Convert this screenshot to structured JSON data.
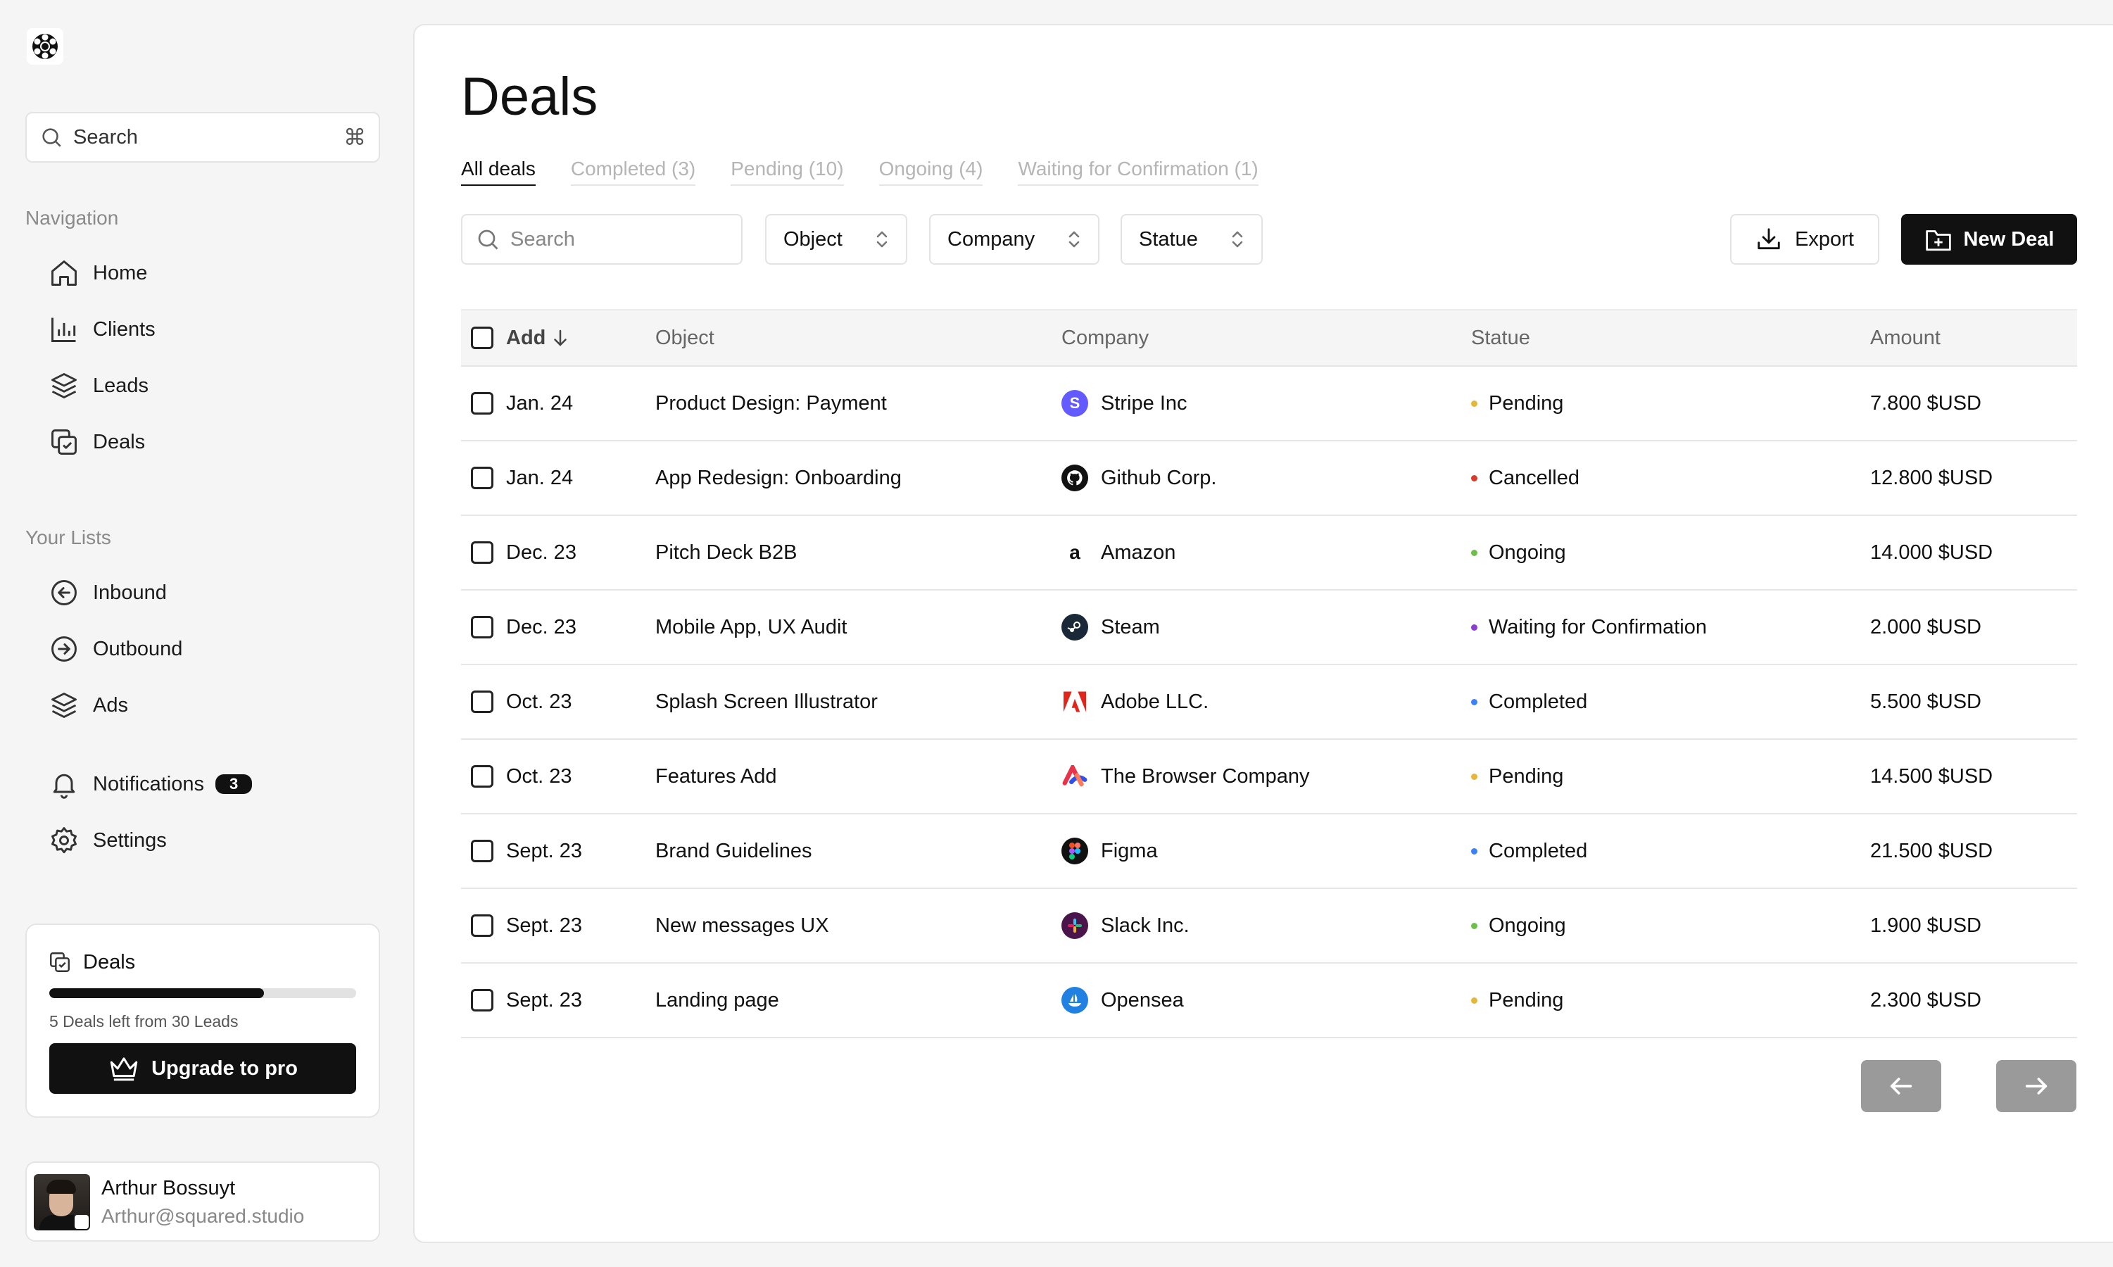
{
  "sidebar": {
    "search": {
      "placeholder": "Search",
      "shortcut": "⌘"
    },
    "nav_heading": "Navigation",
    "nav": [
      {
        "label": "Home",
        "icon": "home-icon"
      },
      {
        "label": "Clients",
        "icon": "bar-chart-icon"
      },
      {
        "label": "Leads",
        "icon": "layers-icon"
      },
      {
        "label": "Deals",
        "icon": "deals-icon"
      }
    ],
    "lists_heading": "Your Lists",
    "lists": [
      {
        "label": "Inbound",
        "icon": "arrow-left-circle-icon"
      },
      {
        "label": "Outbound",
        "icon": "arrow-right-circle-icon"
      },
      {
        "label": "Ads",
        "icon": "layers-icon"
      }
    ],
    "notifications": {
      "label": "Notifications",
      "count": "3"
    },
    "settings": {
      "label": "Settings"
    },
    "deals_card": {
      "title": "Deals",
      "progress_fraction": 0.7,
      "note": "5 Deals left from 30 Leads",
      "upgrade_label": "Upgrade to pro"
    },
    "user": {
      "name": "Arthur Bossuyt",
      "email": "Arthur@squared.studio"
    }
  },
  "main": {
    "title": "Deals",
    "tabs": [
      {
        "label": "All deals",
        "active": true
      },
      {
        "label": "Completed (3)",
        "active": false
      },
      {
        "label": "Pending (10)",
        "active": false
      },
      {
        "label": "Ongoing (4)",
        "active": false
      },
      {
        "label": "Waiting for Confirmation (1)",
        "active": false
      }
    ],
    "toolbar": {
      "search_placeholder": "Search",
      "filters": [
        "Object",
        "Company",
        "Statue"
      ],
      "export_label": "Export",
      "new_label": "New Deal"
    },
    "columns": {
      "add": "Add",
      "object": "Object",
      "company": "Company",
      "status": "Statue",
      "amount": "Amount"
    },
    "rows": [
      {
        "date": "Jan. 24",
        "object": "Product Design: Payment",
        "company": "Stripe Inc",
        "logo": "stripe-logo",
        "status": "Pending",
        "amount": "7.800 $USD"
      },
      {
        "date": "Jan. 24",
        "object": "App Redesign: Onboarding",
        "company": "Github Corp.",
        "logo": "github-logo",
        "status": "Cancelled",
        "amount": "12.800 $USD"
      },
      {
        "date": "Dec. 23",
        "object": "Pitch Deck B2B",
        "company": "Amazon",
        "logo": "amazon-logo",
        "status": "Ongoing",
        "amount": "14.000 $USD"
      },
      {
        "date": "Dec. 23",
        "object": "Mobile App, UX Audit",
        "company": "Steam",
        "logo": "steam-logo",
        "status": "Waiting for Confirmation",
        "amount": "2.000 $USD"
      },
      {
        "date": "Oct. 23",
        "object": "Splash Screen Illustrator",
        "company": "Adobe LLC.",
        "logo": "adobe-logo",
        "status": "Completed",
        "amount": "5.500 $USD"
      },
      {
        "date": "Oct. 23",
        "object": "Features Add",
        "company": "The Browser Company",
        "logo": "arc-logo",
        "status": "Pending",
        "amount": "14.500 $USD"
      },
      {
        "date": "Sept. 23",
        "object": "Brand Guidelines",
        "company": "Figma",
        "logo": "figma-logo",
        "status": "Completed",
        "amount": "21.500 $USD"
      },
      {
        "date": "Sept. 23",
        "object": "New messages UX",
        "company": "Slack Inc.",
        "logo": "slack-logo",
        "status": "Ongoing",
        "amount": "1.900 $USD"
      },
      {
        "date": "Sept. 23",
        "object": "Landing page",
        "company": "Opensea",
        "logo": "opensea-logo",
        "status": "Pending",
        "amount": "2.300 $USD"
      }
    ]
  },
  "status_colors": {
    "Pending": "#e8b53b",
    "Cancelled": "#d83a2e",
    "Ongoing": "#6cc04a",
    "Waiting for Confirmation": "#8a3fd1",
    "Completed": "#3b82f6"
  }
}
